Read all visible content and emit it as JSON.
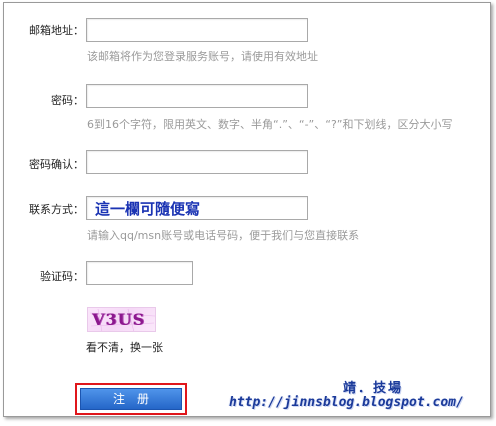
{
  "form": {
    "email": {
      "label": "邮箱地址：",
      "value": "",
      "hint": "该邮箱将作为您登录服务账号，请使用有效地址"
    },
    "password": {
      "label": "密码：",
      "value": "",
      "hint": "6到16个字符，限用英文、数字、半角“.”、“-”、“?”和下划线，区分大小写"
    },
    "confirm_password": {
      "label": "密码确认：",
      "value": ""
    },
    "contact": {
      "label": "联系方式：",
      "value": "這一欄可隨便寫",
      "hint": "请输入qq/msn账号或电话号码，便于我们与您直接联系"
    },
    "captcha": {
      "label": "验证码：",
      "value": "",
      "image_text": "V3US",
      "refresh_label": "看不清，换一张"
    },
    "submit_label": "注册"
  },
  "watermark": {
    "title": "靖．技場",
    "url": "http://jinnsblog.blogspot.com/"
  },
  "colors": {
    "accent_button": "#2566c8",
    "highlight_border": "#e0161b",
    "watermark": "#1b3a9a",
    "contact_text": "#1a33b3"
  }
}
